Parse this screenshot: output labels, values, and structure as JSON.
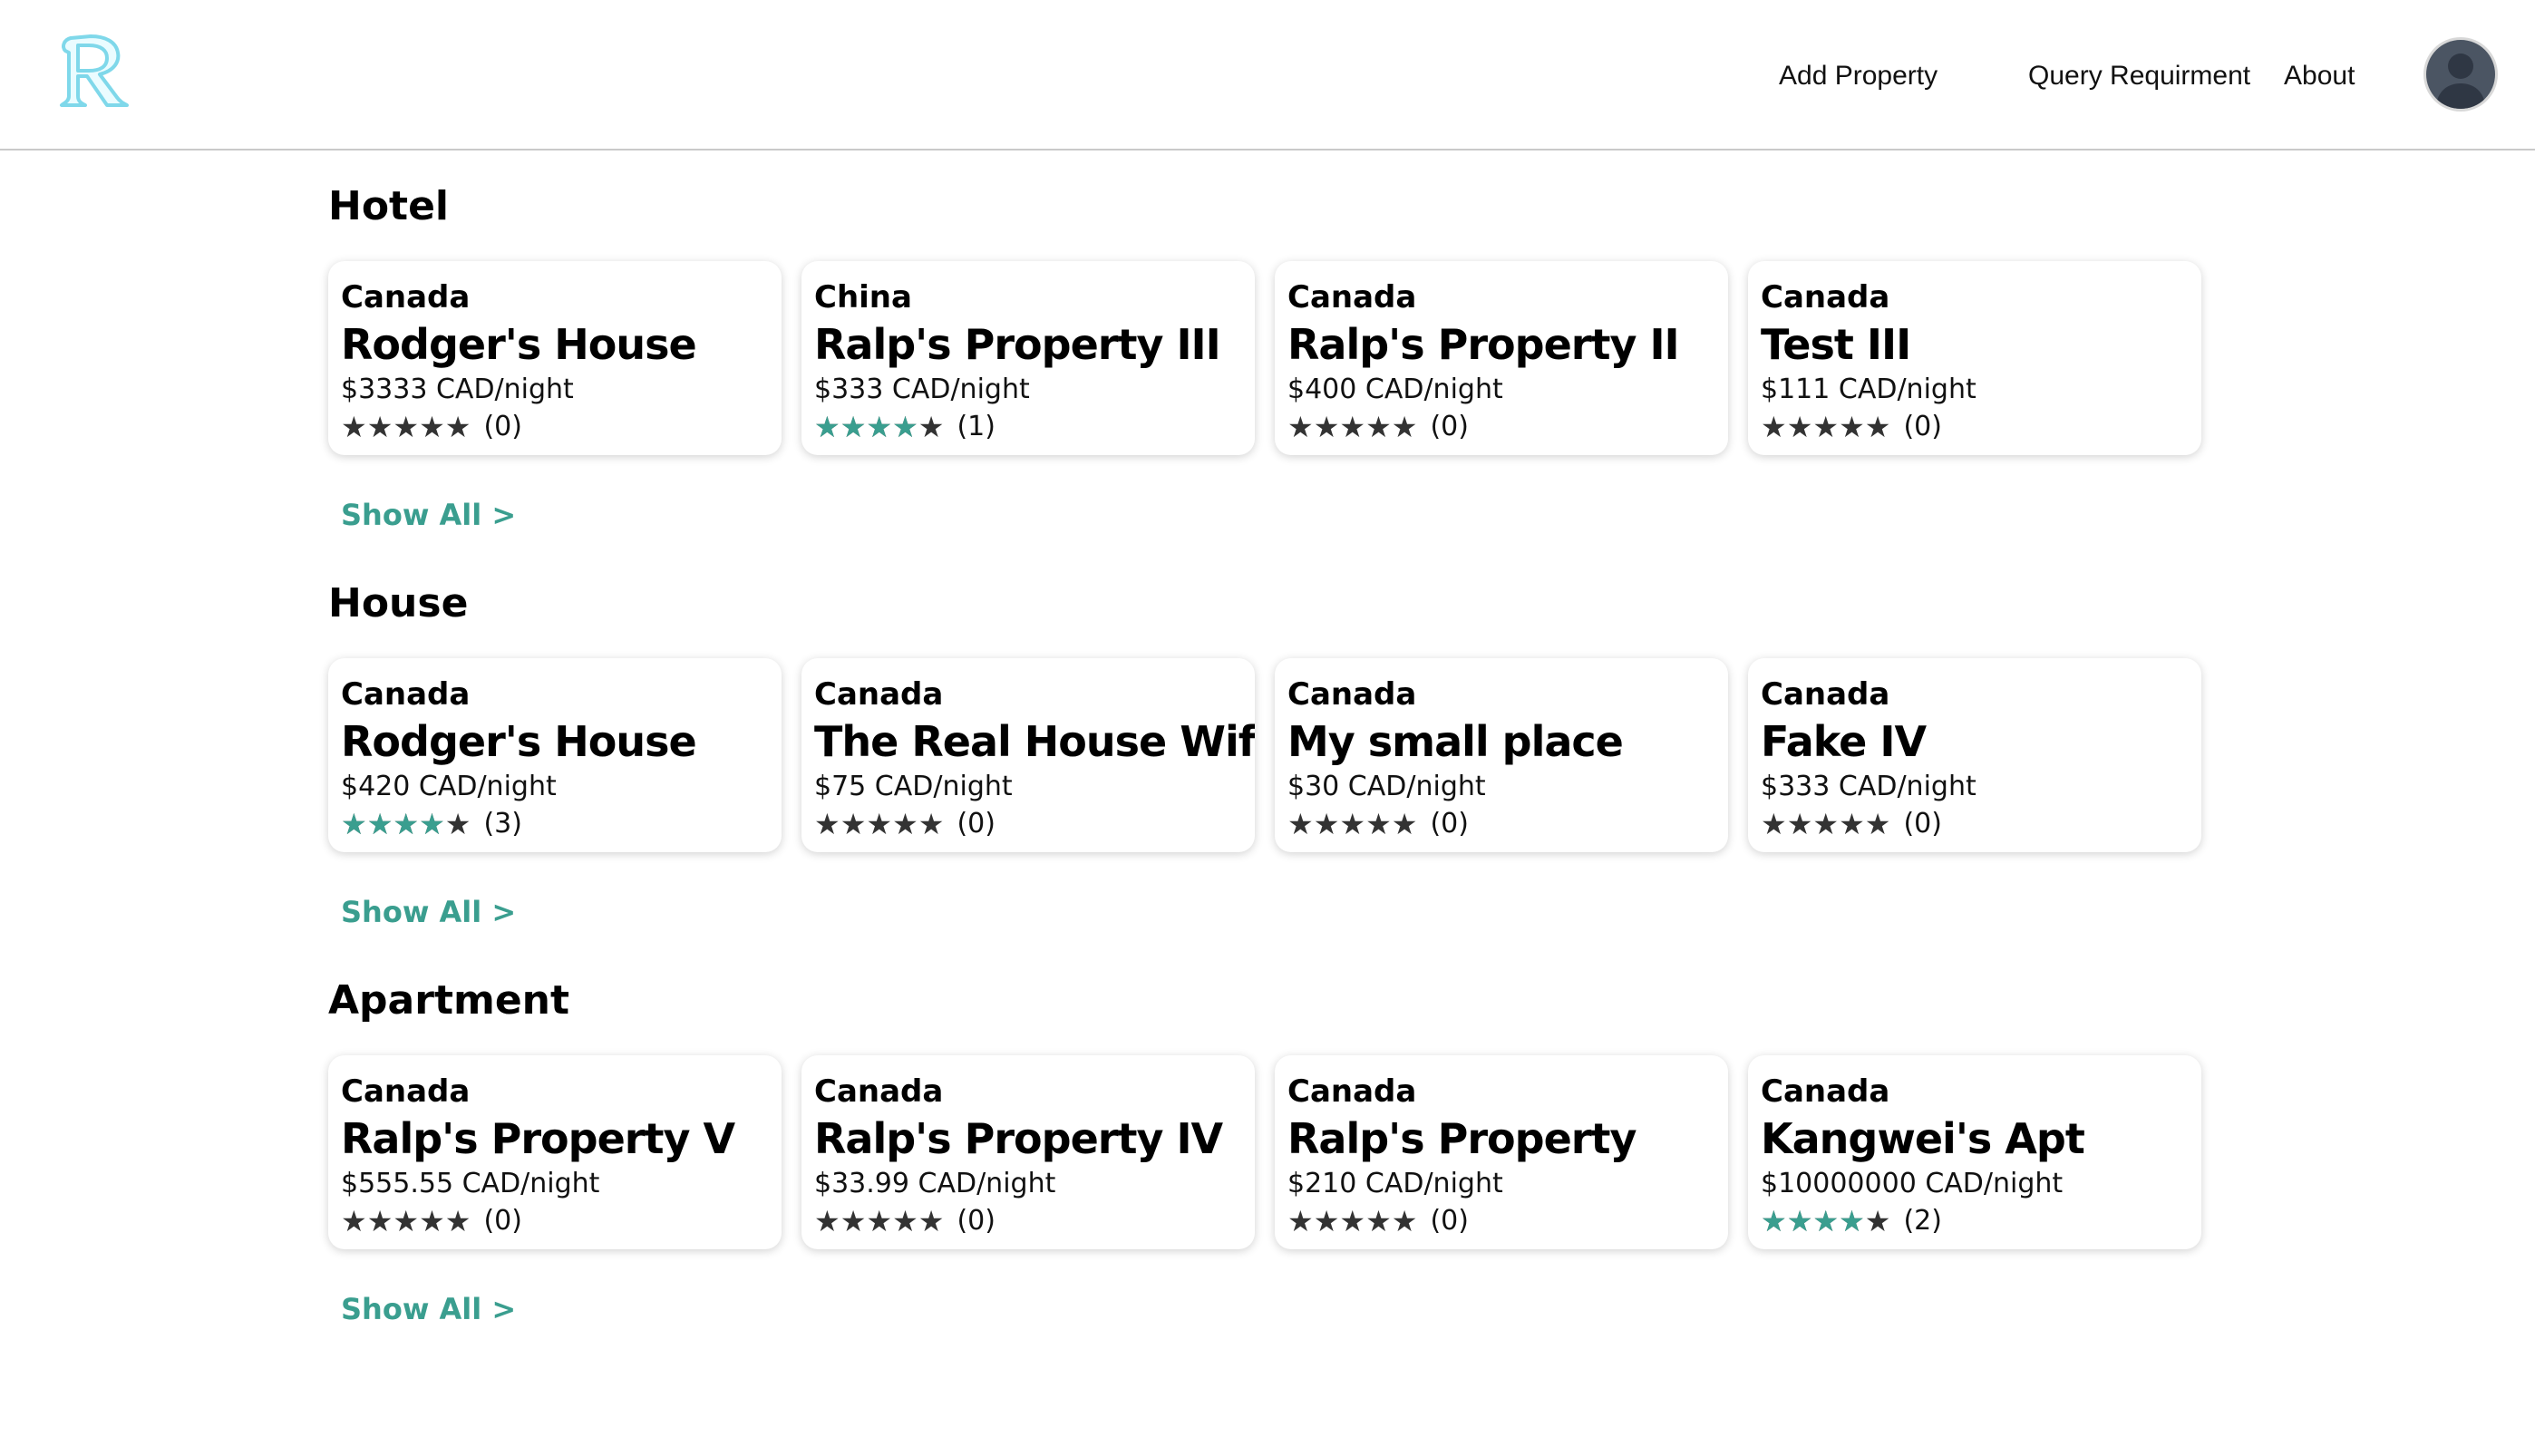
{
  "header": {
    "logo_icon": "r-letter-logo-icon",
    "nav": {
      "add_property": "Add Property",
      "query_requirement": "Query Requirment",
      "about": "About"
    },
    "avatar_icon": "user-avatar-icon"
  },
  "colors": {
    "accent": "#3a9e8f",
    "star_empty": "#333333"
  },
  "sections": [
    {
      "title": "Hotel",
      "show_all": "Show All >",
      "cards": [
        {
          "country": "Canada",
          "name": "Rodger's House",
          "price": "$3333 CAD/night",
          "rating_stars": 0,
          "count": "(0)"
        },
        {
          "country": "China",
          "name": "Ralp's Property III",
          "price": "$333 CAD/night",
          "rating_stars": 4,
          "count": "(1)"
        },
        {
          "country": "Canada",
          "name": "Ralp's Property II",
          "price": "$400 CAD/night",
          "rating_stars": 0,
          "count": "(0)"
        },
        {
          "country": "Canada",
          "name": "Test III",
          "price": "$111 CAD/night",
          "rating_stars": 0,
          "count": "(0)"
        }
      ]
    },
    {
      "title": "House",
      "show_all": "Show All >",
      "cards": [
        {
          "country": "Canada",
          "name": "Rodger's House",
          "price": "$420 CAD/night",
          "rating_stars": 4,
          "count": "(3)"
        },
        {
          "country": "Canada",
          "name": "The Real House Wifes",
          "price": "$75 CAD/night",
          "rating_stars": 0,
          "count": "(0)"
        },
        {
          "country": "Canada",
          "name": "My small place",
          "price": "$30 CAD/night",
          "rating_stars": 0,
          "count": "(0)"
        },
        {
          "country": "Canada",
          "name": "Fake IV",
          "price": "$333 CAD/night",
          "rating_stars": 0,
          "count": "(0)"
        }
      ]
    },
    {
      "title": "Apartment",
      "show_all": "Show All >",
      "cards": [
        {
          "country": "Canada",
          "name": "Ralp's Property V",
          "price": "$555.55 CAD/night",
          "rating_stars": 0,
          "count": "(0)"
        },
        {
          "country": "Canada",
          "name": "Ralp's Property IV",
          "price": "$33.99 CAD/night",
          "rating_stars": 0,
          "count": "(0)"
        },
        {
          "country": "Canada",
          "name": "Ralp's Property",
          "price": "$210 CAD/night",
          "rating_stars": 0,
          "count": "(0)"
        },
        {
          "country": "Canada",
          "name": "Kangwei's Apt",
          "price": "$10000000 CAD/night",
          "rating_stars": 4,
          "count": "(2)"
        }
      ]
    }
  ]
}
